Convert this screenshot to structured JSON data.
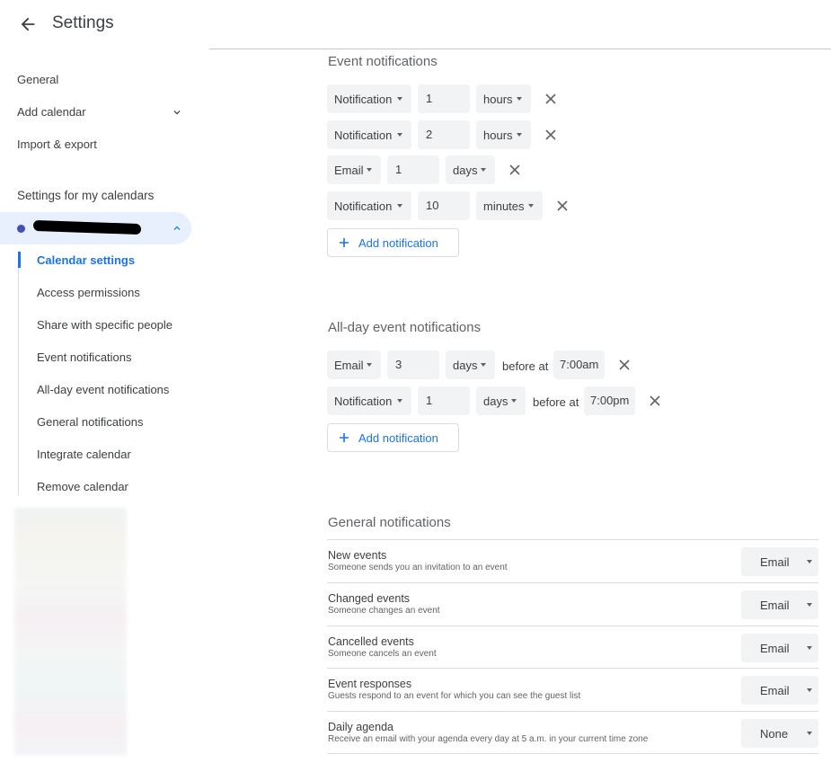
{
  "header": {
    "title": "Settings"
  },
  "sidebar": {
    "general": "General",
    "add_calendar": "Add calendar",
    "import_export": "Import & export",
    "section_title": "Settings for my calendars",
    "sub_items": [
      "Calendar settings",
      "Access permissions",
      "Share with specific people",
      "Event notifications",
      "All-day event notifications",
      "General notifications",
      "Integrate calendar",
      "Remove calendar"
    ]
  },
  "event_notifications": {
    "title": "Event notifications",
    "rows": [
      {
        "type": "Notification",
        "value": "1",
        "unit": "hours"
      },
      {
        "type": "Notification",
        "value": "2",
        "unit": "hours"
      },
      {
        "type": "Email",
        "value": "1",
        "unit": "days"
      },
      {
        "type": "Notification",
        "value": "10",
        "unit": "minutes"
      }
    ],
    "add_label": "Add notification"
  },
  "allday_notifications": {
    "title": "All-day event notifications",
    "rows": [
      {
        "type": "Email",
        "value": "3",
        "unit": "days",
        "before_at": "before at",
        "time": "7:00am"
      },
      {
        "type": "Notification",
        "value": "1",
        "unit": "days",
        "before_at": "before at",
        "time": "7:00pm"
      }
    ],
    "add_label": "Add notification"
  },
  "general_notifications": {
    "title": "General notifications",
    "rows": [
      {
        "title": "New events",
        "desc": "Someone sends you an invitation to an event",
        "value": "Email"
      },
      {
        "title": "Changed events",
        "desc": "Someone changes an event",
        "value": "Email"
      },
      {
        "title": "Cancelled events",
        "desc": "Someone cancels an event",
        "value": "Email"
      },
      {
        "title": "Event responses",
        "desc": "Guests respond to an event for which you can see the guest list",
        "value": "Email"
      },
      {
        "title": "Daily agenda",
        "desc": "Receive an email with your agenda every day at 5 a.m. in your current time zone",
        "value": "None"
      }
    ]
  },
  "colors": {
    "accent": "#1a73e8",
    "calendar_dot": "#3f51b5",
    "selected_bg": "#e8f0fe",
    "field_bg": "#f1f3f4"
  }
}
